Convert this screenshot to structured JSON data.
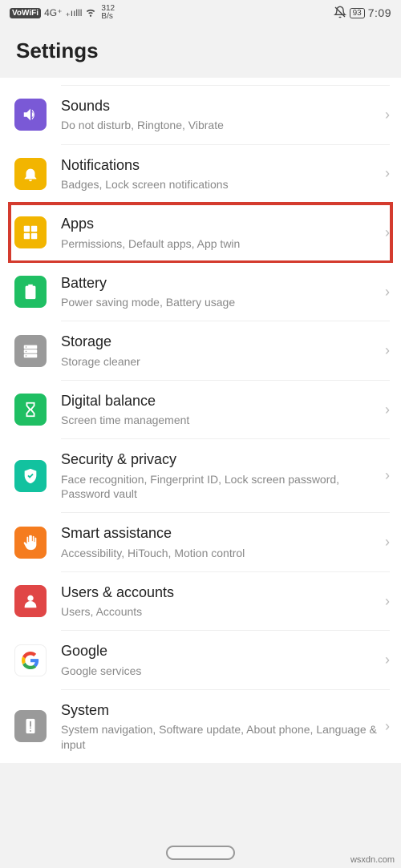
{
  "statusbar": {
    "vowifi": "VoWiFi",
    "signal": "4G⁺",
    "speed_top": "312",
    "speed_bot": "B/s",
    "battery": "93",
    "time": "7:09"
  },
  "header": {
    "title": "Settings"
  },
  "items": [
    {
      "id": "sounds",
      "title": "Sounds",
      "subtitle": "Do not disturb, Ringtone, Vibrate",
      "icon": "speaker-icon",
      "bg": "bg-purple"
    },
    {
      "id": "notifications",
      "title": "Notifications",
      "subtitle": "Badges, Lock screen notifications",
      "icon": "bell-icon",
      "bg": "bg-yellow"
    },
    {
      "id": "apps",
      "title": "Apps",
      "subtitle": "Permissions, Default apps, App twin",
      "icon": "apps-icon",
      "bg": "bg-yellow",
      "highlight": true
    },
    {
      "id": "battery",
      "title": "Battery",
      "subtitle": "Power saving mode, Battery usage",
      "icon": "battery-icon",
      "bg": "bg-green"
    },
    {
      "id": "storage",
      "title": "Storage",
      "subtitle": "Storage cleaner",
      "icon": "storage-icon",
      "bg": "bg-grey"
    },
    {
      "id": "digital-balance",
      "title": "Digital balance",
      "subtitle": "Screen time management",
      "icon": "hourglass-icon",
      "bg": "bg-green"
    },
    {
      "id": "security",
      "title": "Security & privacy",
      "subtitle": "Face recognition, Fingerprint ID, Lock screen password, Password vault",
      "icon": "shield-icon",
      "bg": "bg-teal"
    },
    {
      "id": "smart-assistance",
      "title": "Smart assistance",
      "subtitle": "Accessibility, HiTouch, Motion control",
      "icon": "hand-icon",
      "bg": "bg-orange"
    },
    {
      "id": "users",
      "title": "Users & accounts",
      "subtitle": "Users, Accounts",
      "icon": "user-icon",
      "bg": "bg-red"
    },
    {
      "id": "google",
      "title": "Google",
      "subtitle": "Google services",
      "icon": "google-icon",
      "bg": "bg-white"
    },
    {
      "id": "system",
      "title": "System",
      "subtitle": "System navigation, Software update, About phone, Language & input",
      "icon": "phone-icon",
      "bg": "bg-grey"
    }
  ],
  "watermark": "wsxdn.com"
}
